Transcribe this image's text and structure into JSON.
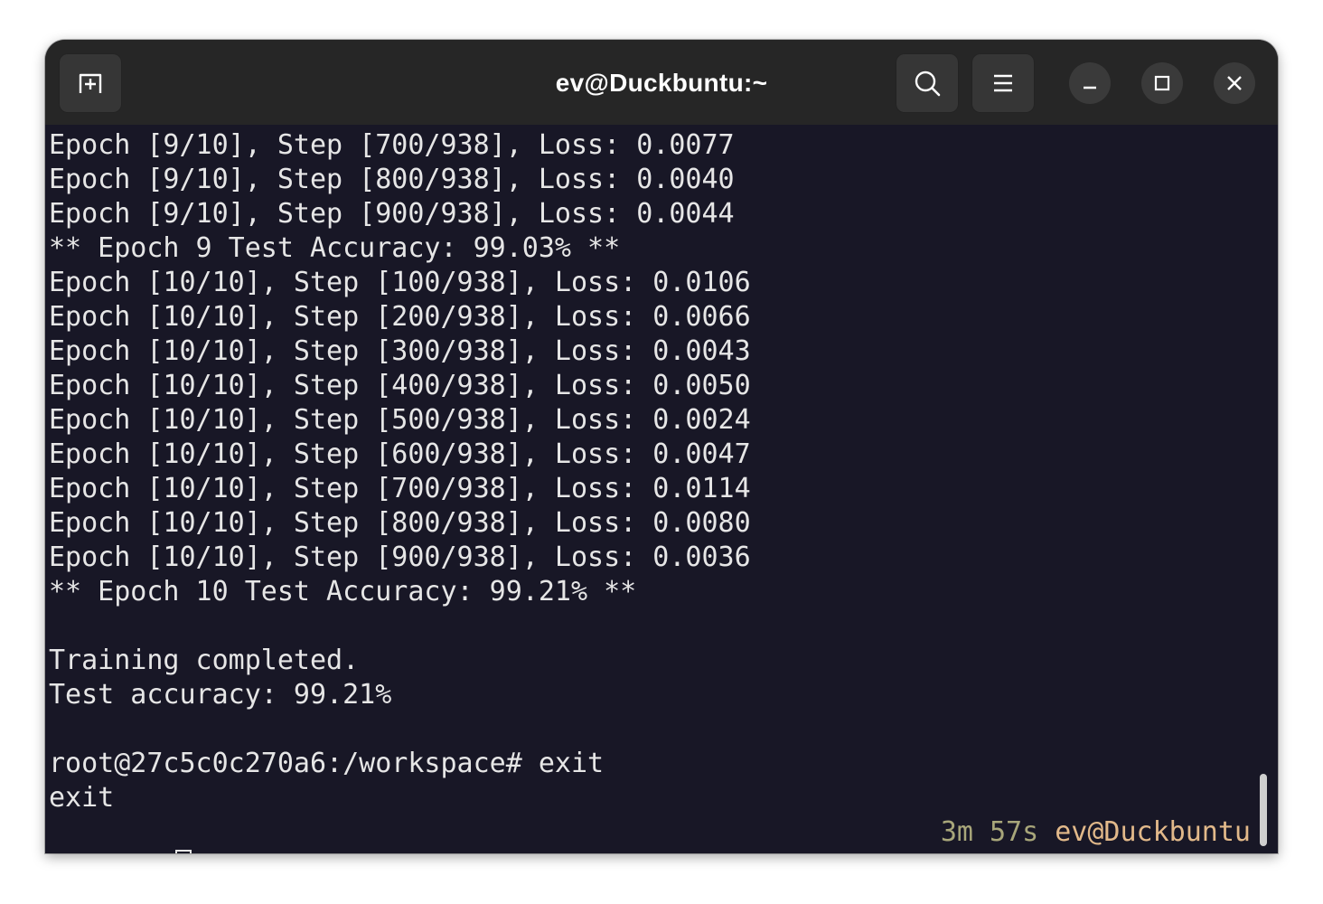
{
  "window": {
    "title": "ev@Duckbuntu:~"
  },
  "headerbar": {
    "new_tab_icon": "new-tab-icon",
    "search_icon": "search-icon",
    "menu_icon": "hamburger-menu-icon",
    "minimize_icon": "minimize-icon",
    "maximize_icon": "maximize-icon",
    "close_icon": "close-icon"
  },
  "terminal": {
    "lines": [
      "Epoch [9/10], Step [700/938], Loss: 0.0077",
      "Epoch [9/10], Step [800/938], Loss: 0.0040",
      "Epoch [9/10], Step [900/938], Loss: 0.0044",
      "** Epoch 9 Test Accuracy: 99.03% **",
      "Epoch [10/10], Step [100/938], Loss: 0.0106",
      "Epoch [10/10], Step [200/938], Loss: 0.0066",
      "Epoch [10/10], Step [300/938], Loss: 0.0043",
      "Epoch [10/10], Step [400/938], Loss: 0.0050",
      "Epoch [10/10], Step [500/938], Loss: 0.0024",
      "Epoch [10/10], Step [600/938], Loss: 0.0047",
      "Epoch [10/10], Step [700/938], Loss: 0.0114",
      "Epoch [10/10], Step [800/938], Loss: 0.0080",
      "Epoch [10/10], Step [900/938], Loss: 0.0036",
      "** Epoch 10 Test Accuracy: 99.21% **"
    ],
    "summary": [
      "Training completed.",
      "Test accuracy: 99.21%"
    ],
    "command_line": "root@27c5c0c270a6:/workspace# exit",
    "output_line": "exit",
    "prompt": {
      "dir": "~",
      "symbol": "❯",
      "duration": "3m 57s",
      "host": "ev@Duckbuntu"
    }
  },
  "colors": {
    "background": "#181726",
    "headerbar": "#262626",
    "prompt_dir": "#26a0e6",
    "prompt_symbol": "#36d13c",
    "duration": "#a8a67a",
    "host": "#e2b98a"
  }
}
